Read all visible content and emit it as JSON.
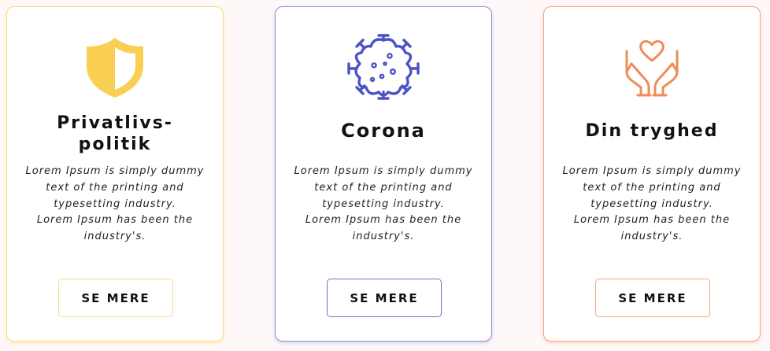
{
  "colors": {
    "page_background": "#fff8f8",
    "card_yellow": "#f6dc86",
    "card_blue": "#8b8fd6",
    "card_orange": "#f2a57e",
    "shield_icon": "#f9cf53",
    "virus_icon": "#4b52c6",
    "hands_icon": "#ee8c5a"
  },
  "cards": [
    {
      "icon": "shield-icon",
      "title": "Privatlivs-politik",
      "description": [
        "Lorem Ipsum is simply dummy",
        "text of the printing and",
        "typesetting industry.",
        "Lorem Ipsum has been the",
        "industry's."
      ],
      "button_label": "SE MERE"
    },
    {
      "icon": "virus-icon",
      "title": "Corona",
      "description": [
        "Lorem Ipsum is simply dummy",
        "text of the printing and",
        "typesetting industry.",
        "Lorem Ipsum has been the",
        "industry's."
      ],
      "button_label": "SE MERE"
    },
    {
      "icon": "hands-heart-icon",
      "title": "Din tryghed",
      "description": [
        "Lorem Ipsum is simply dummy",
        "text of the printing and",
        "typesetting industry.",
        "Lorem Ipsum has been the",
        "industry's."
      ],
      "button_label": "SE MERE"
    }
  ]
}
